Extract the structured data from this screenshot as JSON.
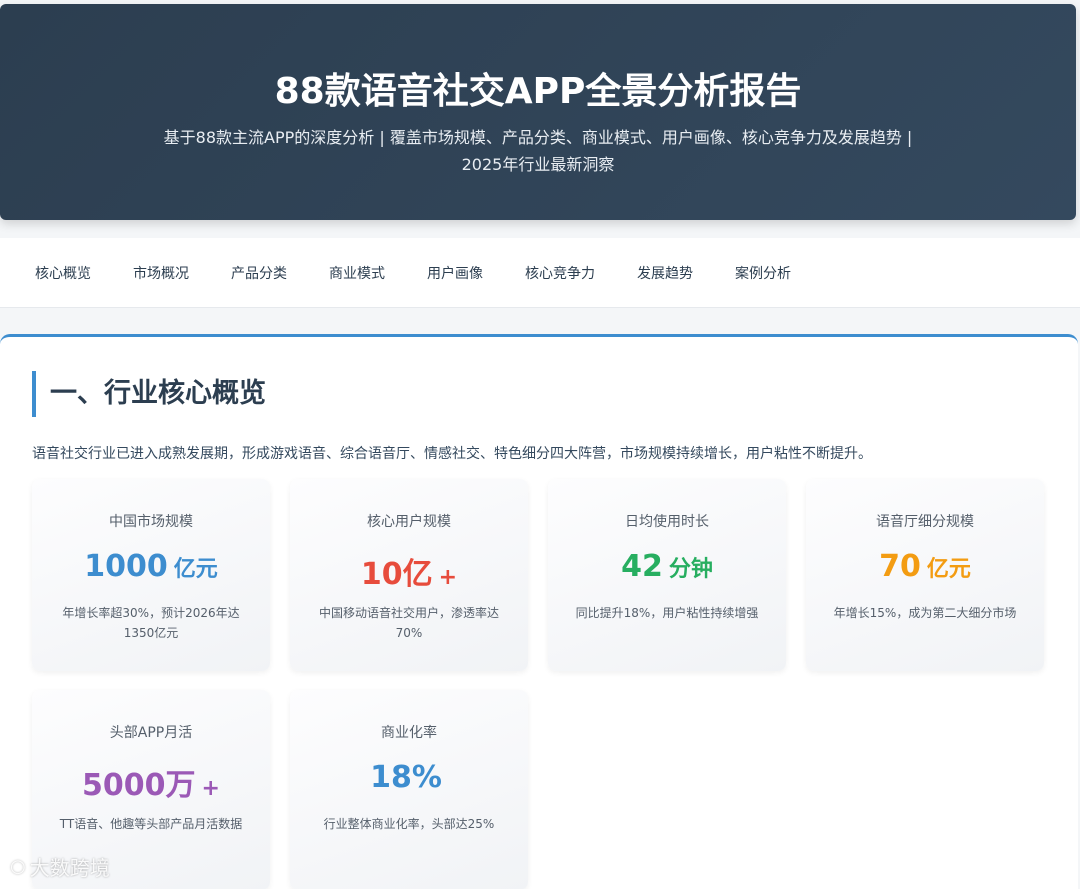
{
  "hero": {
    "title": "88款语音社交APP全景分析报告",
    "subtitle": "基于88款主流APP的深度分析 | 覆盖市场规模、产品分类、商业模式、用户画像、核心竞争力及发展趋势 | 2025年行业最新洞察"
  },
  "nav": {
    "items": [
      {
        "label": "核心概览"
      },
      {
        "label": "市场概况"
      },
      {
        "label": "产品分类"
      },
      {
        "label": "商业模式"
      },
      {
        "label": "用户画像"
      },
      {
        "label": "核心竞争力"
      },
      {
        "label": "发展趋势"
      },
      {
        "label": "案例分析"
      }
    ]
  },
  "section": {
    "title": "一、行业核心概览",
    "description": "语音社交行业已进入成熟发展期，形成游戏语音、综合语音厅、情感社交、特色细分四大阵营，市场规模持续增长，用户粘性不断提升。"
  },
  "cards": [
    {
      "label": "中国市场规模",
      "value": "1000",
      "unit": "亿元",
      "note": "年增长率超30%，预计2026年达1350亿元",
      "color": "#3d8dcf"
    },
    {
      "label": "核心用户规模",
      "value": "10亿",
      "unit": "+",
      "note": "中国移动语音社交用户，渗透率达70%",
      "color": "#e74c3c"
    },
    {
      "label": "日均使用时长",
      "value": "42",
      "unit": "分钟",
      "note": "同比提升18%，用户粘性持续增强",
      "color": "#27ae60"
    },
    {
      "label": "语音厅细分规模",
      "value": "70",
      "unit": "亿元",
      "note": "年增长15%，成为第二大细分市场",
      "color": "#f39c12"
    },
    {
      "label": "头部APP月活",
      "value": "5000万",
      "unit": "+",
      "note": "TT语音、他趣等头部产品月活数据",
      "color": "#9b59b6"
    },
    {
      "label": "商业化率",
      "value": "18%",
      "unit": "",
      "note": "行业整体商业化率，头部达25%",
      "color": "#3d8dcf"
    }
  ],
  "watermark": {
    "text": "大数跨境"
  }
}
